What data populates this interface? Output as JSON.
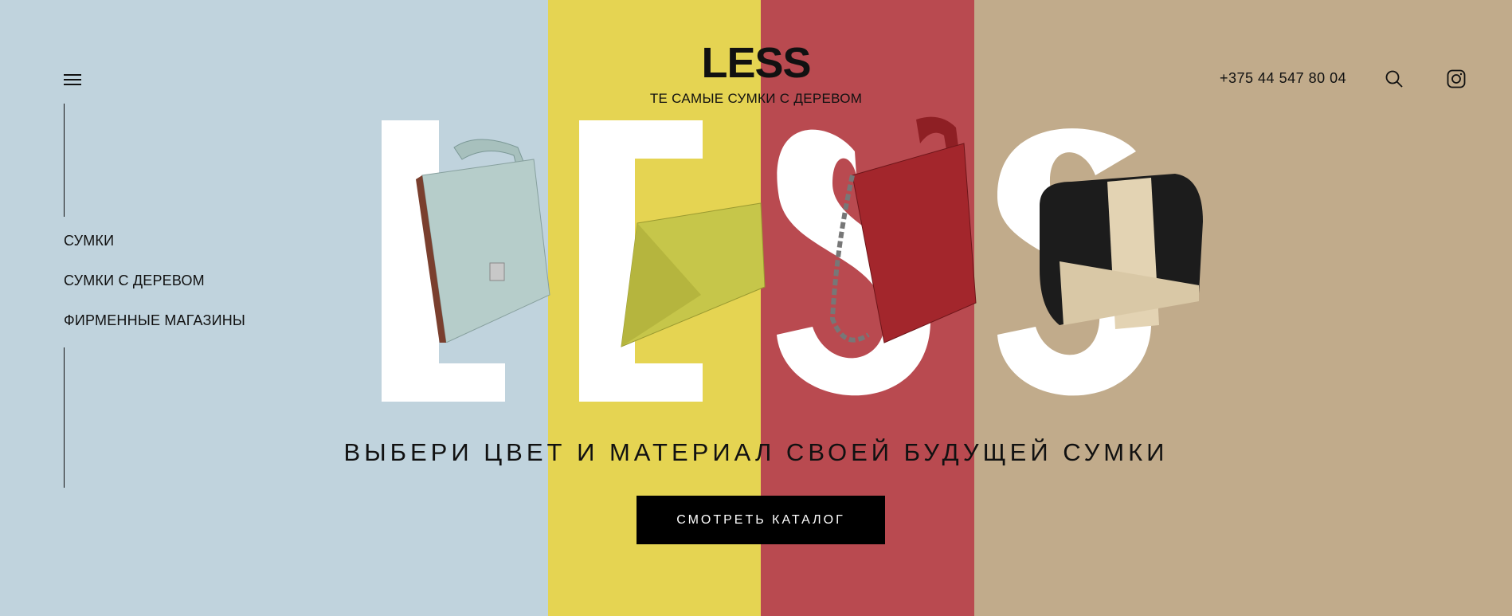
{
  "brand": {
    "logo": "LESS",
    "tagline": "ТЕ САМЫЕ СУМКИ С ДЕРЕВОМ"
  },
  "header": {
    "phone": "+375 44 547 80 04",
    "icons": [
      "hamburger-menu-icon",
      "search-icon",
      "instagram-icon"
    ]
  },
  "sidebar": {
    "items": [
      {
        "label": "СУМКИ"
      },
      {
        "label": "СУМКИ С ДЕРЕВОМ"
      },
      {
        "label": "ФИРМЕННЫЕ МАГАЗИНЫ"
      }
    ]
  },
  "hero": {
    "letters": [
      "L",
      "E",
      "S",
      "S"
    ],
    "headline": "ВЫБЕРИ ЦВЕТ И МАТЕРИАЛ СВОЕЙ БУДУЩЕЙ СУМКИ",
    "cta_label": "СМОТРЕТЬ КАТАЛОГ"
  },
  "colors": {
    "stripe_blue": "#c0d3dd",
    "stripe_yellow": "#e5d452",
    "stripe_red": "#b94a50",
    "stripe_beige": "#c1ab8b",
    "button_bg": "#000000",
    "text": "#111111"
  }
}
